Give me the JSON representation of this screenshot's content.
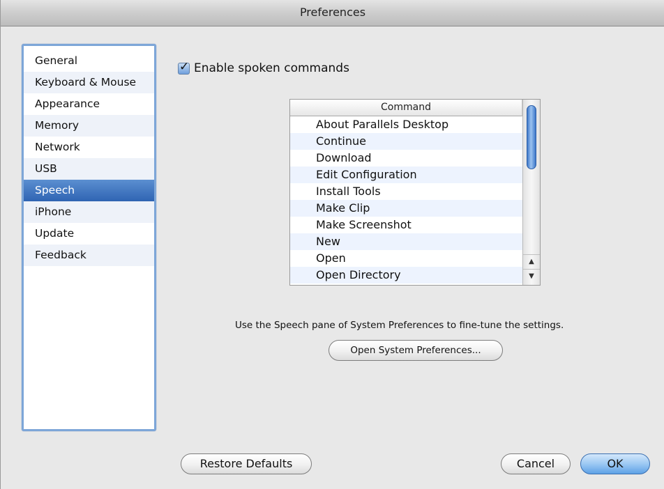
{
  "window": {
    "title": "Preferences"
  },
  "sidebar": {
    "items": [
      {
        "label": "General",
        "selected": false
      },
      {
        "label": "Keyboard & Mouse",
        "selected": false
      },
      {
        "label": "Appearance",
        "selected": false
      },
      {
        "label": "Memory",
        "selected": false
      },
      {
        "label": "Network",
        "selected": false
      },
      {
        "label": "USB",
        "selected": false
      },
      {
        "label": "Speech",
        "selected": true
      },
      {
        "label": "iPhone",
        "selected": false
      },
      {
        "label": "Update",
        "selected": false
      },
      {
        "label": "Feedback",
        "selected": false
      }
    ]
  },
  "speech": {
    "enable_label": "Enable spoken commands",
    "enable_checked": true,
    "table": {
      "header": "Command",
      "rows": [
        "About Parallels Desktop",
        "Continue",
        "Download",
        "Edit Configuration",
        "Install Tools",
        "Make Clip",
        "Make Screenshot",
        "New",
        "Open",
        "Open Directory"
      ]
    },
    "hint": "Use the Speech pane of System Preferences to fine-tune the settings.",
    "open_system_prefs_label": "Open System Preferences..."
  },
  "footer": {
    "restore_label": "Restore Defaults",
    "cancel_label": "Cancel",
    "ok_label": "OK"
  },
  "colors": {
    "selection": "#3a6fc0",
    "accent": "#7da6d8"
  }
}
